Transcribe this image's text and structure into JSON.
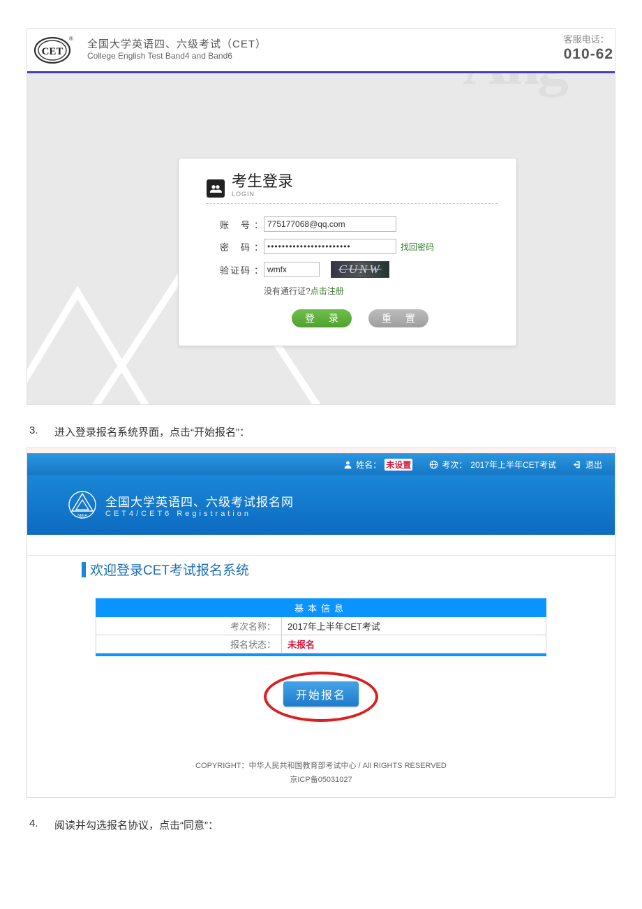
{
  "shot1": {
    "header": {
      "title_zh": "全国大学英语四、六级考试（CET）",
      "title_en": "College English Test Band4 and Band6",
      "hotline_label": "客服电话：",
      "hotline_number": "010-62",
      "logo_text": "CET"
    },
    "login": {
      "title": "考生登录",
      "subtitle": "LOGIN",
      "account_label": "账　号",
      "account_value": "775177068@qq.com",
      "password_label": "密　码",
      "password_value": "•••••••••••••••••••••••",
      "find_pwd": "找回密码",
      "captcha_label": "验证码",
      "captcha_value": "wmfx",
      "captcha_image_text": "CUNW",
      "register_hint_prefix": "没有通行证?",
      "register_link": "点击注册",
      "login_btn": "登 录",
      "reset_btn": "重 置",
      "colon": "："
    }
  },
  "step3": {
    "num": "3.",
    "text": "进入登录报名系统界面，点击“开始报名”："
  },
  "shot2": {
    "topbar": {
      "name_label": "姓名：",
      "name_value": "未设置",
      "session_label": "考次：",
      "session_value": "2017年上半年CET考试",
      "logout": "退出"
    },
    "banner": {
      "title_zh": "全国大学英语四、六级考试报名网",
      "title_en": "CET4/CET6   Registration"
    },
    "welcome": "欢迎登录CET考试报名系统",
    "table": {
      "header": "基本信息",
      "row1_k": "考次名称：",
      "row1_v": "2017年上半年CET考试",
      "row2_k": "报名状态：",
      "row2_v": "未报名"
    },
    "start_btn": "开始报名",
    "copyright_line1": "COPYRIGHT：中华人民共和国教育部考试中心 / All RIGHTS RESERVED",
    "copyright_line2": "京ICP备05031027"
  },
  "step4": {
    "num": "4.",
    "text": "阅读并勾选报名协议，点击“同意”："
  }
}
